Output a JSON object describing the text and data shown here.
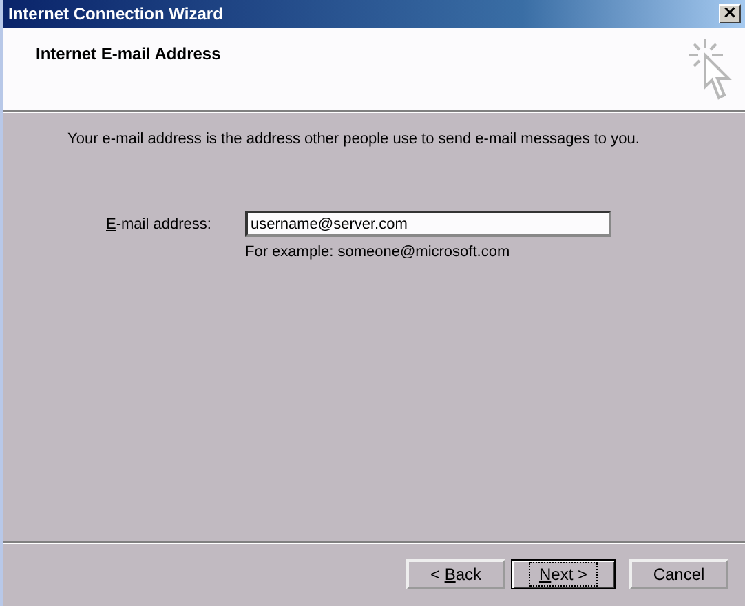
{
  "window": {
    "title": "Internet Connection Wizard",
    "close": "×"
  },
  "header": {
    "title": "Internet E-mail Address"
  },
  "description": "Your e-mail address is the address other people use to send e-mail messages to you.",
  "field": {
    "label": {
      "mnemonic": "E",
      "rest": "-mail address:"
    },
    "value": "username@server.com",
    "hint": "For example: someone@microsoft.com"
  },
  "buttons": [
    {
      "before": "< ",
      "mnemonic": "B",
      "rest": "ack",
      "default": false,
      "focused": false
    },
    {
      "mnemonic": "N",
      "rest": "ext >",
      "default": true,
      "focused": true
    },
    {
      "rest": "Cancel",
      "default": false,
      "focused": false
    }
  ]
}
